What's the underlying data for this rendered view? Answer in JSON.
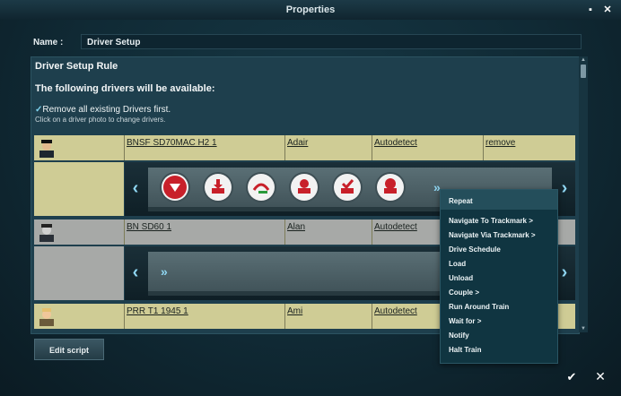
{
  "window": {
    "title": "Properties"
  },
  "name_field": {
    "label": "Name :",
    "value": "Driver Setup"
  },
  "rule": {
    "title": "Driver Setup Rule",
    "subtitle": "The following drivers will be available:",
    "checkbox_label": "Remove all existing Drivers first.",
    "checkbox_checked": true,
    "hint": "Click on a driver photo to change drivers."
  },
  "drivers": [
    {
      "train": "BNSF SD70MAC H2 1",
      "driver": "Adair",
      "mode": "Autodetect",
      "action": "remove"
    },
    {
      "train": "BN SD60 1",
      "driver": "Alan",
      "mode": "Autodetect",
      "action": ""
    },
    {
      "train": "PRR T1 1945 1",
      "driver": "Ami",
      "mode": "Autodetect",
      "action": ""
    }
  ],
  "instruction_icons": [
    "stop-icon",
    "unload-icon",
    "couple-icon",
    "load-icon",
    "schedule-icon",
    "halt-icon"
  ],
  "context_menu": {
    "items": [
      "Repeat",
      "Navigate To Trackmark >",
      "Navigate Via Trackmark >",
      "Drive Schedule",
      "Load",
      "Unload",
      "Couple >",
      "Run Around Train",
      "Wait for >",
      "Notify",
      "Halt Train"
    ]
  },
  "buttons": {
    "edit_script": "Edit script",
    "ok": "✔",
    "close": "✕"
  },
  "colors": {
    "row_tan": "#cfcc95",
    "row_gray": "#a7a9a7",
    "accent": "#8fd6f2"
  }
}
